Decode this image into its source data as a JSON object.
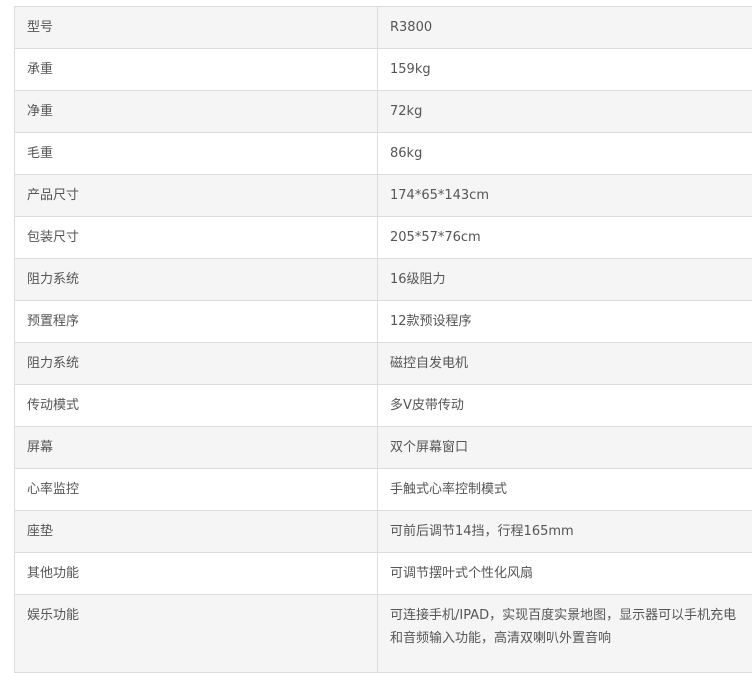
{
  "specs": [
    {
      "label": "型号",
      "value": "R3800"
    },
    {
      "label": "承重",
      "value": "159kg"
    },
    {
      "label": "净重",
      "value": "72kg"
    },
    {
      "label": "毛重",
      "value": "86kg"
    },
    {
      "label": "产品尺寸",
      "value": "174*65*143cm"
    },
    {
      "label": "包装尺寸",
      "value": "205*57*76cm"
    },
    {
      "label": "阻力系统",
      "value": "16级阻力"
    },
    {
      "label": "预置程序",
      "value": "12款预设程序"
    },
    {
      "label": "阻力系统",
      "value": "磁控自发电机"
    },
    {
      "label": "传动模式",
      "value": "多V皮带传动"
    },
    {
      "label": "屏幕",
      "value": "双个屏幕窗口"
    },
    {
      "label": "心率监控",
      "value": "手触式心率控制模式"
    },
    {
      "label": "座垫",
      "value": "可前后调节14挡，行程165mm"
    },
    {
      "label": "其他功能",
      "value": "可调节摆叶式个性化风扇"
    },
    {
      "label": "娱乐功能",
      "value": "可连接手机/IPAD，实现百度实景地图，显示器可以手机充电和音频输入功能，高清双喇叭外置音响"
    }
  ]
}
